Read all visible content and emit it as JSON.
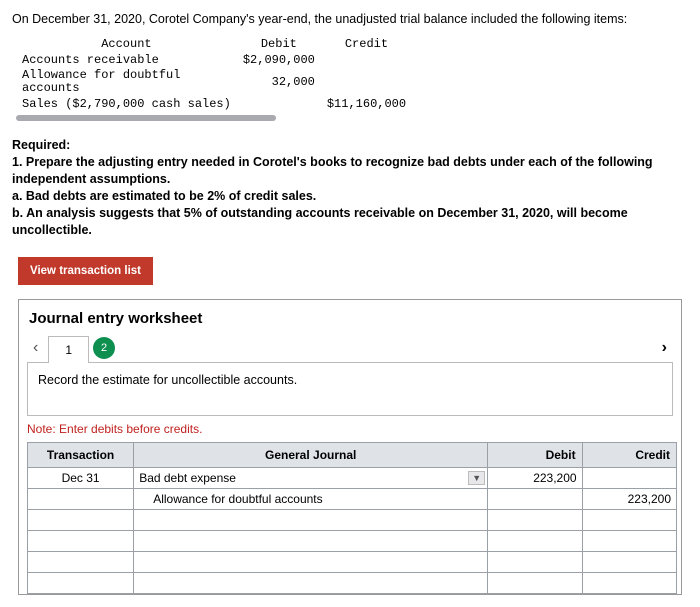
{
  "intro": "On December 31, 2020, Corotel Company's year-end, the unadjusted trial balance included the following items:",
  "trial_balance": {
    "headers": {
      "account": "Account",
      "debit": "Debit",
      "credit": "Credit"
    },
    "rows": [
      {
        "account": "Accounts receivable",
        "debit": "$2,090,000",
        "credit": ""
      },
      {
        "account": "Allowance for doubtful accounts",
        "debit": "32,000",
        "credit": ""
      },
      {
        "account": "Sales ($2,790,000 cash sales)",
        "debit": "",
        "credit": "$11,160,000"
      }
    ]
  },
  "required": {
    "heading": "Required:",
    "line1": "1. Prepare the adjusting entry needed in Corotel's books to recognize bad debts under each of the following independent assumptions.",
    "a": "a. Bad debts are estimated to be 2% of credit sales.",
    "b": "b. An analysis suggests that 5% of outstanding accounts receivable on December 31, 2020, will become uncollectible."
  },
  "view_btn": "View transaction list",
  "worksheet": {
    "title": "Journal entry worksheet",
    "tabs": {
      "t1": "1",
      "t2": "2"
    },
    "instruction": "Record the estimate for uncollectible accounts.",
    "note": "Note: Enter debits before credits.",
    "headers": {
      "txn": "Transaction",
      "gj": "General Journal",
      "debit": "Debit",
      "credit": "Credit"
    },
    "rows": [
      {
        "date": "Dec 31",
        "gj": "Bad debt expense",
        "debit": "223,200",
        "credit": ""
      },
      {
        "date": "",
        "gj": "Allowance for doubtful accounts",
        "debit": "",
        "credit": "223,200"
      },
      {
        "date": "",
        "gj": "",
        "debit": "",
        "credit": ""
      },
      {
        "date": "",
        "gj": "",
        "debit": "",
        "credit": ""
      },
      {
        "date": "",
        "gj": "",
        "debit": "",
        "credit": ""
      },
      {
        "date": "",
        "gj": "",
        "debit": "",
        "credit": ""
      }
    ]
  }
}
